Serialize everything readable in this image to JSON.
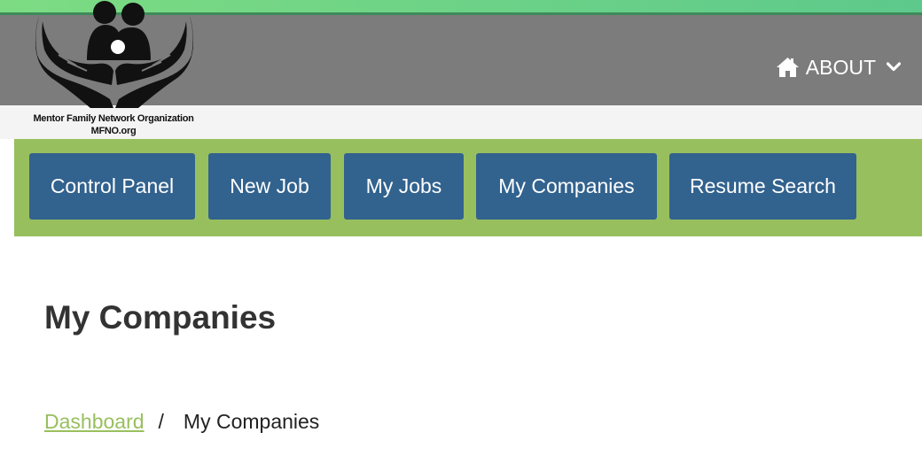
{
  "brand": {
    "org_name": "Mentor Family Network Organization",
    "org_site": "MFNO.org"
  },
  "header": {
    "about_label": "ABOUT",
    "about_icon": "home-icon",
    "dropdown_icon": "chevron-down-icon"
  },
  "nav": {
    "items": [
      {
        "label": "Control Panel"
      },
      {
        "label": "New Job"
      },
      {
        "label": "My Jobs"
      },
      {
        "label": "My Companies"
      },
      {
        "label": "Resume Search"
      }
    ]
  },
  "main": {
    "title": "My Companies",
    "breadcrumb": {
      "home": "Dashboard",
      "separator": "/",
      "current": "My Companies"
    }
  },
  "colors": {
    "accent_green": "#98bf5e",
    "button_blue": "#32628e",
    "header_gray": "#7c7c7c",
    "top_strip": "#5dc98b"
  }
}
